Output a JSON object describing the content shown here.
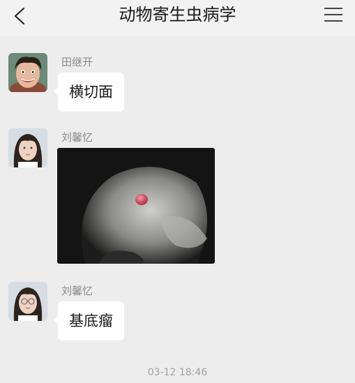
{
  "header": {
    "title": "动物寄生虫病学",
    "back_icon": "chevron-left-icon",
    "menu_icon": "hamburger-menu-icon"
  },
  "messages": [
    {
      "sender": "田继开",
      "type": "text",
      "text": "横切面"
    },
    {
      "sender": "刘馨忆",
      "type": "image"
    },
    {
      "sender": "刘馨忆",
      "type": "text",
      "text": "基底瘤"
    }
  ],
  "timestamp": "03-12 18:46",
  "colors": {
    "background": "#ededed",
    "bubble": "#ffffff",
    "header": "#f2f2f2"
  }
}
